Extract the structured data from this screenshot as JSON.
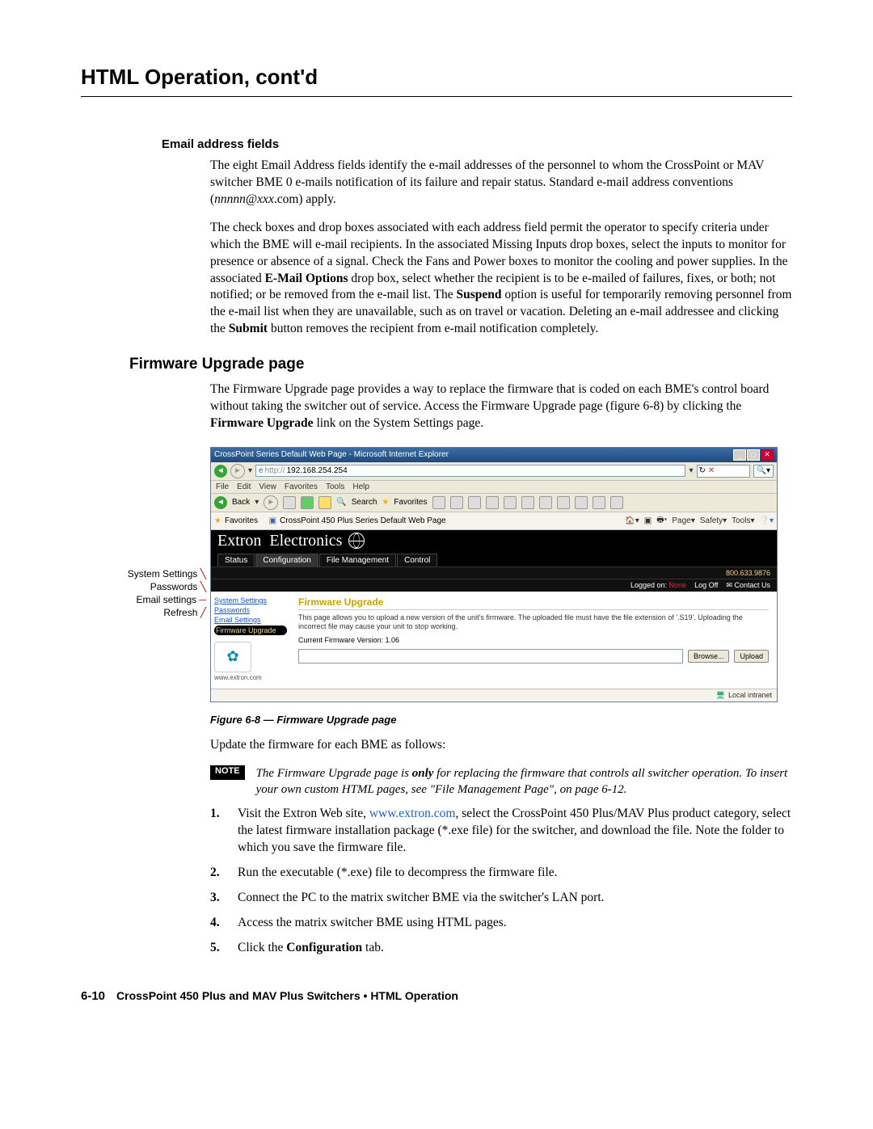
{
  "chapterTitle": "HTML Operation, cont'd",
  "emailHeading": "Email address fields",
  "emailPara1_a": "The eight Email Address fields identify the e-mail addresses of the personnel to whom the CrossPoint or MAV switcher BME 0 e-mails notification of its failure and repair status.  Standard e-mail address conventions (",
  "emailPara1_em": "nnnnn@xxx",
  "emailPara1_b": ".com) apply.",
  "emailPara2_a": "The check boxes and drop boxes associated with each address field permit the operator to specify criteria under which the BME will e-mail recipients.  In the associated Missing Inputs drop boxes, select the inputs to monitor for presence or absence of a signal.  Check the Fans and Power boxes to monitor the cooling and power supplies.  In the associated ",
  "emailPara2_b1": "E-Mail Options",
  "emailPara2_b": " drop box, select whether the recipient is to be e-mailed of failures, fixes, or both; not notified; or be removed from the e-mail list.  The ",
  "emailPara2_b2": "Suspend",
  "emailPara2_c": " option is useful for temporarily removing personnel from the e-mail list when they are unavailable, such as on travel or vacation.  Deleting an e-mail addressee and clicking the ",
  "emailPara2_b3": "Submit",
  "emailPara2_d": " button removes the recipient from e-mail notification completely.",
  "fwHeading": "Firmware Upgrade page",
  "fwPara_a": "The Firmware Upgrade page provides a way to replace the firmware that is coded on each BME's control board without taking the switcher out of service.  Access the Firmware Upgrade page (figure 6-8) by clicking the ",
  "fwPara_b1": "Firmware Upgrade",
  "fwPara_b": " link on the System Settings page.",
  "callouts": {
    "c1": "System Settings",
    "c2": "Passwords",
    "c3": "Email settings",
    "c4": "Refresh"
  },
  "browser": {
    "title": "CrossPoint Series Default Web Page - Microsoft Internet Explorer",
    "addrPrefix": "http://",
    "address": "192.168.254.254",
    "menus": [
      "File",
      "Edit",
      "View",
      "Favorites",
      "Tools",
      "Help"
    ],
    "back": "Back",
    "search": "Search",
    "favorites": "Favorites",
    "favLabel": "Favorites",
    "tabTitle": "CrossPoint 450 Plus Series Default Web Page",
    "rightTools": [
      "Page",
      "Safety",
      "Tools"
    ],
    "extronTitle": "Extron  Electronics",
    "tabs": [
      "Status",
      "Configuration",
      "File Management",
      "Control"
    ],
    "phone": "800.633.9876",
    "loggedOnLabel": "Logged on:",
    "loggedOnVal": "None",
    "logoff": "Log Off",
    "contact": "Contact Us",
    "side": {
      "i1": "System Settings",
      "i2": "Passwords",
      "i3": "Email Settings",
      "i4": "Firmware Upgrade",
      "site": "www.extron.com"
    },
    "fwTitle": "Firmware Upgrade",
    "fwDesc": "This page allows you to upload a new version of the unit's firmware. The uploaded file must have the file extension of '.S19'. Uploading the incorrect file may cause your unit to stop working.",
    "fwVer": "Current Firmware Version: 1.06",
    "browseBtn": "Browse...",
    "uploadBtn": "Upload",
    "status": "Local intranet"
  },
  "figCaption": "Figure 6-8 — Firmware Upgrade page",
  "updateLine": "Update the firmware for each BME as follows:",
  "noteBadge": "NOTE",
  "noteText_a": "The Firmware Upgrade page is ",
  "noteText_b": "only",
  "noteText_c": " for replacing the firmware that controls all switcher operation.  To insert your own custom HTML pages, see \"File Management Page\", on page 6-12.",
  "steps": {
    "s1_a": "Visit the Extron Web site, ",
    "s1_link": "www.extron.com",
    "s1_b": ", select the CrossPoint 450 Plus/MAV Plus product category, select the latest firmware installation package (*.exe file) for the switcher, and download the file.  Note the folder to which you save the firmware file.",
    "s2": "Run the executable (*.exe) file to decompress the firmware file.",
    "s3": "Connect the PC to the matrix switcher BME via the switcher's LAN port.",
    "s4": "Access the matrix switcher BME using HTML pages.",
    "s5_a": "Click the ",
    "s5_b": "Configuration",
    "s5_c": " tab."
  },
  "footer": {
    "page": "6-10",
    "text": "CrossPoint 450 Plus and MAV Plus Switchers • HTML Operation"
  }
}
